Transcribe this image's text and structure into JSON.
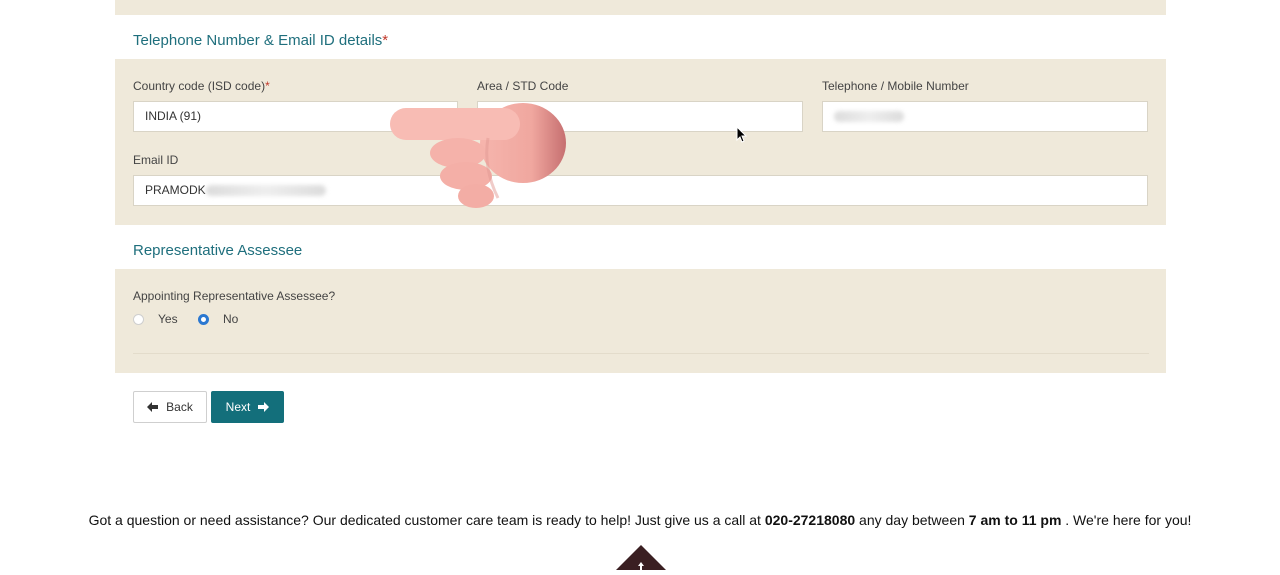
{
  "sections": {
    "telephone_title": "Telephone Number & Email ID details",
    "telephone_title_req": "*",
    "representative_title": "Representative Assessee"
  },
  "fields": {
    "country_code": {
      "label": "Country code (ISD code)",
      "required": "*",
      "value": "INDIA (91)"
    },
    "area_code": {
      "label": "Area / STD Code",
      "value": ""
    },
    "telephone": {
      "label": "Telephone / Mobile Number"
    },
    "email": {
      "label": "Email ID",
      "value_visible": "PRAMODK"
    }
  },
  "representative": {
    "question": "Appointing Representative Assessee?",
    "options": [
      {
        "label": "Yes",
        "selected": false
      },
      {
        "label": "No",
        "selected": true
      }
    ]
  },
  "buttons": {
    "back": "Back",
    "next": "Next"
  },
  "footer": {
    "text_1": "Got a question or need assistance? Our dedicated customer care team is ready to help! Just give us a call at ",
    "phone": "020-27218080",
    "text_2": " any day between ",
    "hours": "7 am to 11 pm",
    "text_3": " . We're here for you!"
  },
  "colors": {
    "panel_bg": "#efe9da",
    "title_teal": "#1f6f7d",
    "primary_button": "#136f7b",
    "radio_selected": "#2b78d1",
    "scroll_top_bg": "#3a1f22"
  },
  "icons": [
    "arrow-left-icon",
    "arrow-right-icon",
    "arrow-up-icon",
    "mouse-cursor-icon",
    "pointing-hand-icon"
  ]
}
